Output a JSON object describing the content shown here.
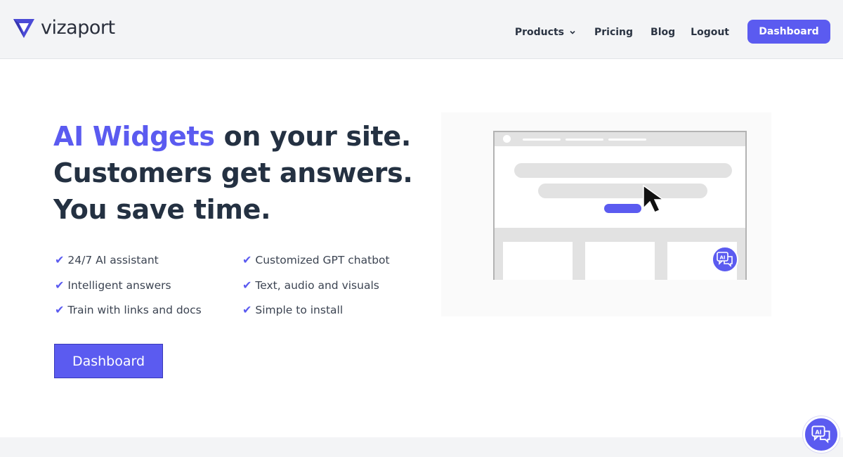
{
  "brand": {
    "name": "vizaport",
    "accent": "#5b5bf0"
  },
  "nav": {
    "products": "Products",
    "pricing": "Pricing",
    "blog": "Blog",
    "logout": "Logout",
    "dashboard": "Dashboard"
  },
  "hero": {
    "title_accent": "AI Widgets",
    "title_rest": " on your site.",
    "line2": "Customers get answers.",
    "line3": "You save time."
  },
  "features": {
    "check": "✔",
    "items": [
      "24/7 AI assistant",
      "Customized GPT chatbot",
      "Intelligent answers",
      "Text, audio and visuals",
      "Train with links and docs",
      "Simple to install"
    ]
  },
  "cta": {
    "label": "Dashboard"
  },
  "icons": {
    "logo": "vizaport-logo-icon",
    "chevron": "chevron-down-icon",
    "cursor": "cursor-arrow-icon",
    "chat": "ai-chat-icon"
  },
  "chat_icon_text": "AI"
}
